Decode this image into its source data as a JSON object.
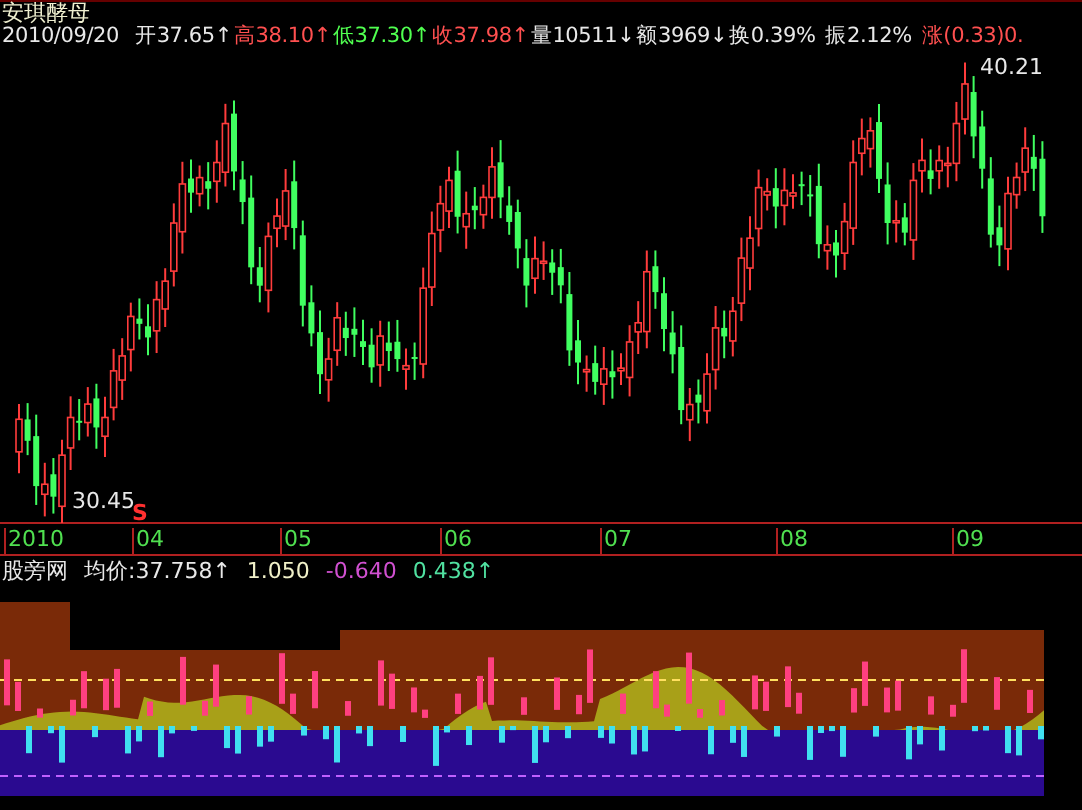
{
  "stock_name": "安琪酵母",
  "quote": {
    "date": "2010/09/20",
    "items": [
      {
        "label": "开",
        "value": "37.65",
        "arrow": "↑",
        "color": "#e8e8e8"
      },
      {
        "label": "高",
        "value": "38.10",
        "arrow": "↑",
        "color": "#ff5050"
      },
      {
        "label": "低",
        "value": "37.30",
        "arrow": "↑",
        "color": "#50ff50"
      },
      {
        "label": "收",
        "value": "37.98",
        "arrow": "↑",
        "color": "#ff5050"
      },
      {
        "label": "量",
        "value": "10511",
        "arrow": "↓",
        "color": "#e8e8e8"
      },
      {
        "label": "额",
        "value": "3969",
        "arrow": "↓",
        "color": "#e8e8e8"
      },
      {
        "label": "换",
        "value": "0.39%",
        "color": "#e8e8e8"
      },
      {
        "label": "振",
        "value": "2.12%",
        "color": "#e8e8e8"
      },
      {
        "label": "涨",
        "value": "(0.33)0.",
        "color": "#ff5050"
      }
    ]
  },
  "price_chart": {
    "high_label": "40.21",
    "low_label": "30.45",
    "signal": "S"
  },
  "x_axis": [
    "2010",
    "04",
    "05",
    "06",
    "07",
    "08",
    "09"
  ],
  "indicator": {
    "name": "股旁网",
    "items": [
      {
        "text": "均价:37.758",
        "arrow": "↑",
        "color": "#e8e8e8"
      },
      {
        "text": "1.050",
        "color": "#f0f0c8"
      },
      {
        "text": "-0.640",
        "color": "#d050d0"
      },
      {
        "text": "0.438",
        "arrow": "↑",
        "color": "#50e0a0"
      }
    ]
  }
}
